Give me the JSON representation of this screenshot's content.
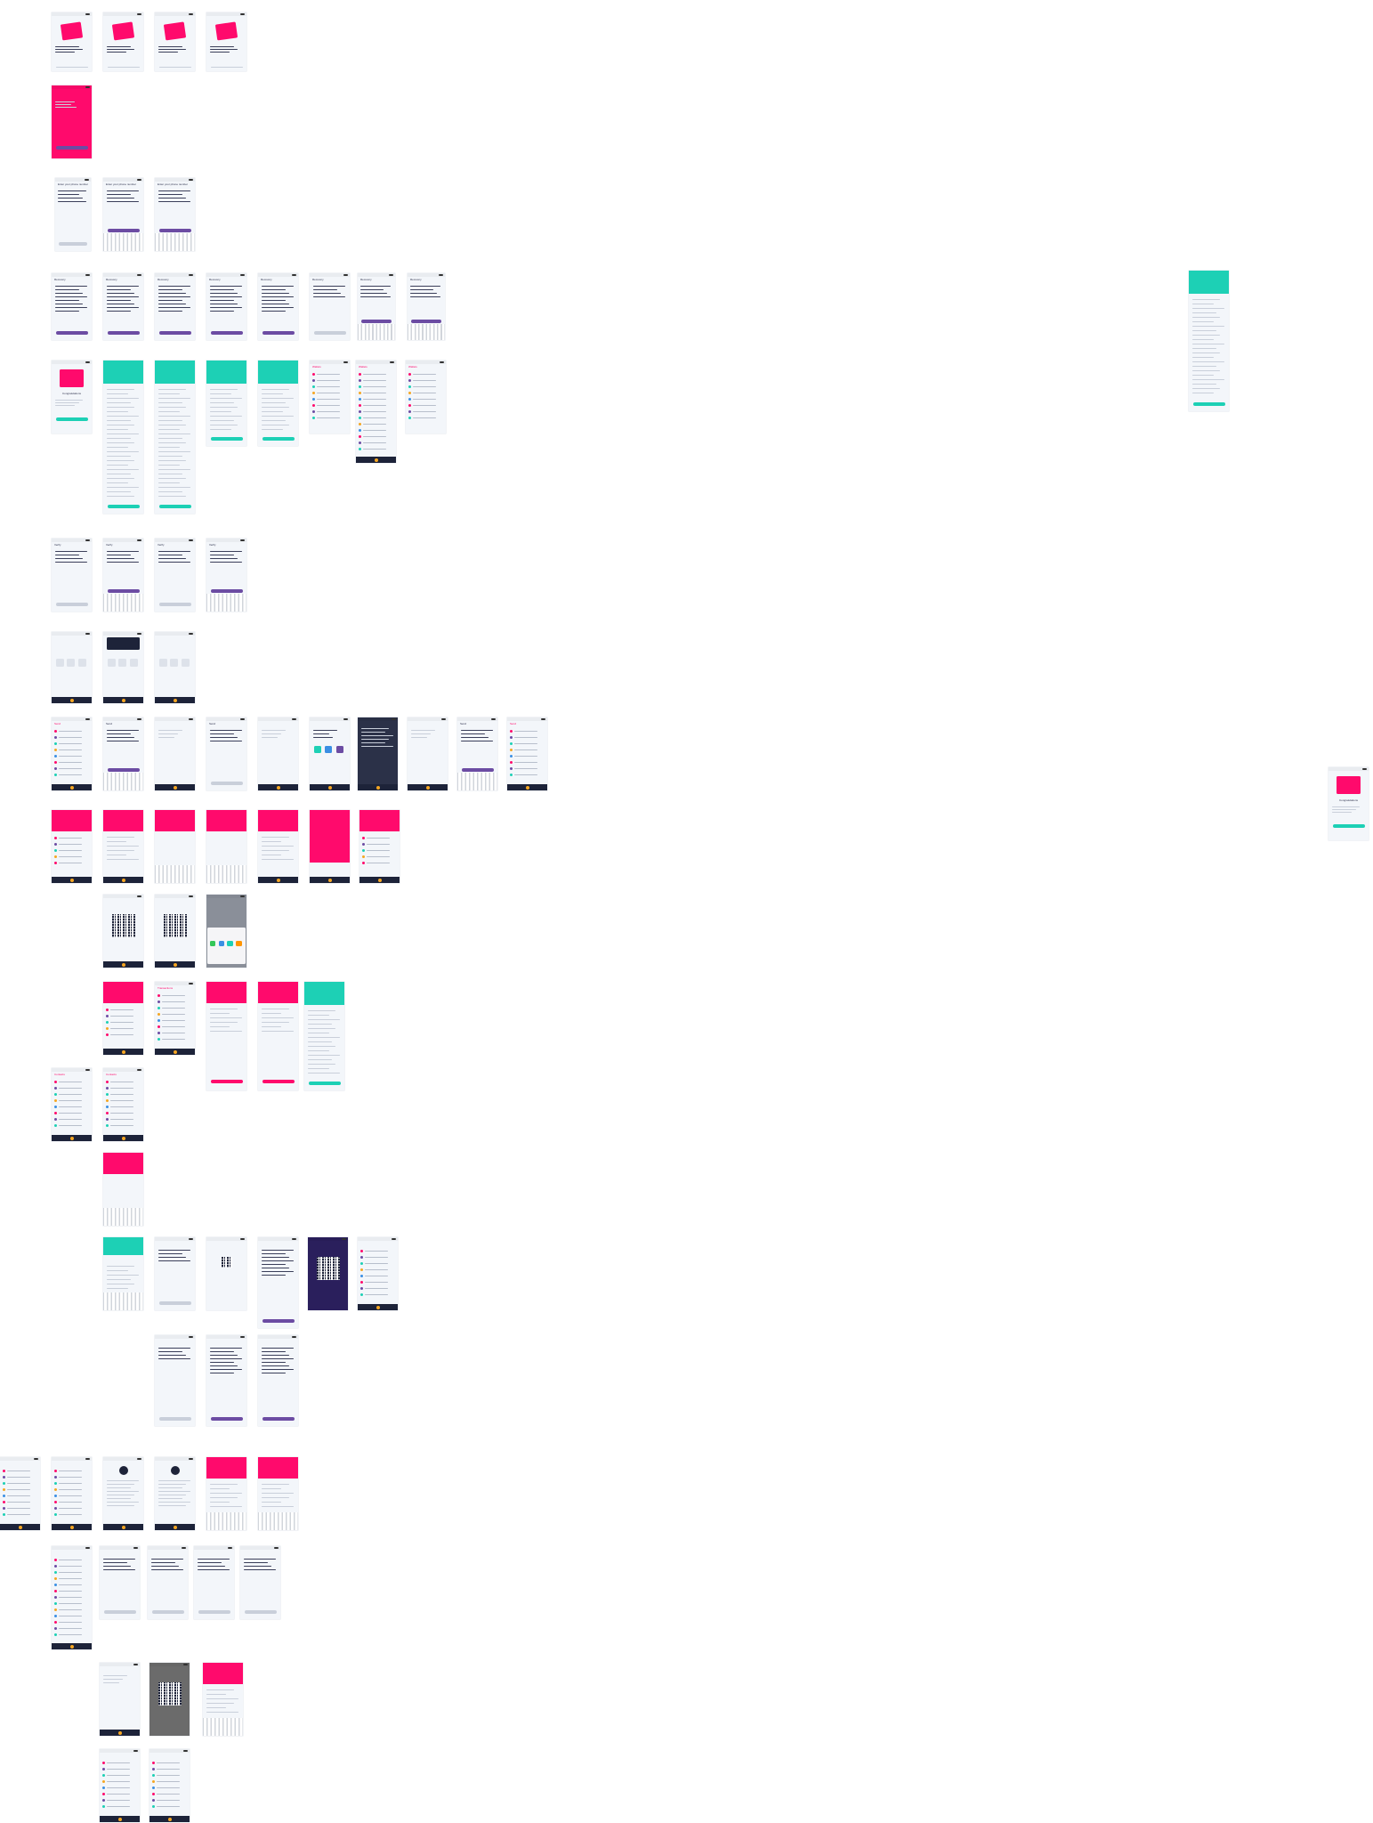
{
  "canvas": {
    "background": "#ffffff"
  },
  "colors": {
    "pink": "#ff0a6c",
    "teal": "#1dd0b5",
    "purple": "#6c4ca3",
    "navy": "#1d2339",
    "screen": "#f3f6fa"
  },
  "screens": [
    {
      "id": "onboarding-1",
      "title": "Keep Bits Ctrl",
      "variant": "onboard"
    },
    {
      "id": "onboarding-2",
      "title": "Keep Bits Ctrl",
      "variant": "onboard"
    },
    {
      "id": "onboarding-3",
      "title": "Keep Bits Ctrl",
      "variant": "onboard"
    },
    {
      "id": "onboarding-4",
      "title": "Keep Bits Ctrl",
      "variant": "onboard"
    },
    {
      "id": "splash",
      "title": "Keep Bits Ctrl",
      "variant": "splash"
    },
    {
      "id": "phone-entry-1",
      "title": "Enter your phone number",
      "variant": "form"
    },
    {
      "id": "phone-entry-2",
      "title": "Enter your phone number",
      "variant": "form-kb"
    },
    {
      "id": "phone-entry-3",
      "title": "Enter your phone number",
      "variant": "form-kb"
    },
    {
      "id": "recovery-1",
      "title": "Recovery",
      "variant": "text"
    },
    {
      "id": "recovery-2",
      "title": "Recovery",
      "variant": "text"
    },
    {
      "id": "recovery-3",
      "title": "Recovery",
      "variant": "text"
    },
    {
      "id": "recovery-4",
      "title": "Recovery",
      "variant": "text"
    },
    {
      "id": "recovery-5",
      "title": "Recovery",
      "variant": "text"
    },
    {
      "id": "recovery-6",
      "title": "Recovery",
      "variant": "form"
    },
    {
      "id": "recovery-7",
      "title": "Recovery",
      "variant": "form-kb"
    },
    {
      "id": "recovery-8",
      "title": "Recovery",
      "variant": "form-kb"
    },
    {
      "id": "teal-detail",
      "title": "",
      "variant": "teal-long"
    },
    {
      "id": "wallet-created",
      "title": "Congratulations",
      "variant": "card"
    },
    {
      "id": "terms-1",
      "title": "",
      "variant": "teal-long"
    },
    {
      "id": "terms-2",
      "title": "",
      "variant": "teal-long"
    },
    {
      "id": "terms-3",
      "title": "",
      "variant": "teal-mid"
    },
    {
      "id": "terms-4",
      "title": "",
      "variant": "teal-mid"
    },
    {
      "id": "wallets-list-1",
      "title": "Wallets",
      "variant": "list"
    },
    {
      "id": "wallets-list-2",
      "title": "Wallets",
      "variant": "list-tab"
    },
    {
      "id": "wallets-list-3",
      "title": "Wallets",
      "variant": "list"
    },
    {
      "id": "verify-1",
      "title": "Verify",
      "variant": "form"
    },
    {
      "id": "verify-2",
      "title": "Verify",
      "variant": "form-kb"
    },
    {
      "id": "verify-3",
      "title": "Verify",
      "variant": "form"
    },
    {
      "id": "verify-4",
      "title": "Verify",
      "variant": "form-kb"
    },
    {
      "id": "empty-1",
      "title": "",
      "variant": "empty"
    },
    {
      "id": "empty-2",
      "title": "",
      "variant": "dialog"
    },
    {
      "id": "empty-3",
      "title": "",
      "variant": "empty"
    },
    {
      "id": "send-1",
      "title": "Send",
      "variant": "list-tab"
    },
    {
      "id": "send-2",
      "title": "Send",
      "variant": "form-kb"
    },
    {
      "id": "send-3",
      "title": "Send",
      "variant": "plain"
    },
    {
      "id": "send-4",
      "title": "Send",
      "variant": "form"
    },
    {
      "id": "send-5",
      "title": "Send",
      "variant": "plain"
    },
    {
      "id": "send-6",
      "title": "Send",
      "variant": "apps"
    },
    {
      "id": "send-7",
      "title": "Send",
      "variant": "dark"
    },
    {
      "id": "send-8",
      "title": "Send",
      "variant": "plain"
    },
    {
      "id": "send-9",
      "title": "Send",
      "variant": "form-kb"
    },
    {
      "id": "send-10",
      "title": "Send",
      "variant": "list-tab"
    },
    {
      "id": "send-11",
      "title": "Send",
      "variant": "list-tab"
    },
    {
      "id": "congrats-right",
      "title": "Congratulations",
      "variant": "card"
    },
    {
      "id": "amount-1",
      "title": "Amount",
      "variant": "pink-list"
    },
    {
      "id": "amount-2",
      "title": "Amount",
      "variant": "pink-form"
    },
    {
      "id": "amount-3",
      "title": "Amount",
      "variant": "pink-kb"
    },
    {
      "id": "amount-4",
      "title": "Amount",
      "variant": "pink-kb"
    },
    {
      "id": "amount-5",
      "title": "Amount",
      "variant": "pink-form"
    },
    {
      "id": "amount-6",
      "title": "Amount",
      "variant": "pink-full"
    },
    {
      "id": "amount-7",
      "title": "Amount",
      "variant": "pink-list"
    },
    {
      "id": "receive-1",
      "title": "Receive",
      "variant": "qr"
    },
    {
      "id": "receive-2",
      "title": "Receive",
      "variant": "qr"
    },
    {
      "id": "share-sheet",
      "title": "Share",
      "variant": "share"
    },
    {
      "id": "tx-1",
      "title": "Transactions",
      "variant": "pink-list"
    },
    {
      "id": "tx-2",
      "title": "Transactions",
      "variant": "list-tab"
    },
    {
      "id": "tx-3",
      "title": "Transaction",
      "variant": "pink-detail"
    },
    {
      "id": "tx-4",
      "title": "Transaction",
      "variant": "pink-detail"
    },
    {
      "id": "tx-5",
      "title": "Transaction",
      "variant": "teal-detail"
    },
    {
      "id": "contacts-1",
      "title": "Contacts",
      "variant": "list-tab"
    },
    {
      "id": "contacts-2",
      "title": "Contacts",
      "variant": "list-tab"
    },
    {
      "id": "pink-kb",
      "title": "",
      "variant": "pink-kb-tall"
    },
    {
      "id": "teal-kb",
      "title": "",
      "variant": "teal-kb-tall"
    },
    {
      "id": "pair-1",
      "title": "",
      "variant": "form"
    },
    {
      "id": "pair-2",
      "title": "",
      "variant": "qr-small"
    },
    {
      "id": "pair-3",
      "title": "",
      "variant": "text"
    },
    {
      "id": "pair-qr",
      "title": "",
      "variant": "qr-dark"
    },
    {
      "id": "pair-list",
      "title": "",
      "variant": "list-tab"
    },
    {
      "id": "pair-b1",
      "title": "",
      "variant": "form"
    },
    {
      "id": "pair-b2",
      "title": "",
      "variant": "text"
    },
    {
      "id": "pair-b3",
      "title": "",
      "variant": "text"
    },
    {
      "id": "settings-0",
      "title": "",
      "variant": "list-tab"
    },
    {
      "id": "settings-1",
      "title": "",
      "variant": "list-tab"
    },
    {
      "id": "profile-1",
      "title": "",
      "variant": "profile"
    },
    {
      "id": "profile-2",
      "title": "",
      "variant": "profile"
    },
    {
      "id": "edit-1",
      "title": "",
      "variant": "pink-kb-form"
    },
    {
      "id": "edit-2",
      "title": "",
      "variant": "pink-kb-form"
    },
    {
      "id": "menu-1",
      "title": "",
      "variant": "list-tab"
    },
    {
      "id": "menu-2",
      "title": "",
      "variant": "form"
    },
    {
      "id": "menu-3",
      "title": "",
      "variant": "form"
    },
    {
      "id": "menu-4",
      "title": "",
      "variant": "form"
    },
    {
      "id": "menu-5",
      "title": "",
      "variant": "form"
    },
    {
      "id": "scan-1",
      "title": "",
      "variant": "plain"
    },
    {
      "id": "scan-2",
      "title": "",
      "variant": "qr-photo"
    },
    {
      "id": "scan-3",
      "title": "",
      "variant": "pink-kb-form"
    },
    {
      "id": "final-1",
      "title": "",
      "variant": "list-tab"
    },
    {
      "id": "final-2",
      "title": "",
      "variant": "list-tab"
    }
  ]
}
